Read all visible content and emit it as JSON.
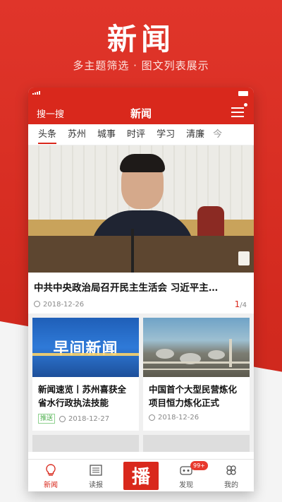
{
  "promo": {
    "title": "新闻",
    "subtitle": "多主题筛选 · 图文列表展示"
  },
  "header": {
    "search_label": "搜一搜",
    "title": "新闻"
  },
  "tabs": [
    {
      "label": "头条",
      "active": true
    },
    {
      "label": "苏州"
    },
    {
      "label": "城事"
    },
    {
      "label": "时评"
    },
    {
      "label": "学习"
    },
    {
      "label": "清廉"
    }
  ],
  "hero": {
    "title": "中共中央政治局召开民主生活会  习近平主…",
    "date": "2018-12-26",
    "page_current": "1",
    "page_total": "/4"
  },
  "cards": [
    {
      "image_text": "早间新闻",
      "title": "新闻速览丨苏州喜获全省水行政执法技能",
      "tag": "推送",
      "date": "2018-12-27"
    },
    {
      "title": "中国首个大型民营炼化项目恒力炼化正式",
      "date": "2018-12-26"
    }
  ],
  "tabbar": {
    "items": [
      {
        "label": "新闻",
        "active": true
      },
      {
        "label": "读报"
      },
      {
        "label": "播"
      },
      {
        "label": "发现",
        "badge": "99+"
      },
      {
        "label": "我的"
      }
    ]
  },
  "colors": {
    "accent": "#d9281c",
    "tag_green": "#4cae4c"
  }
}
